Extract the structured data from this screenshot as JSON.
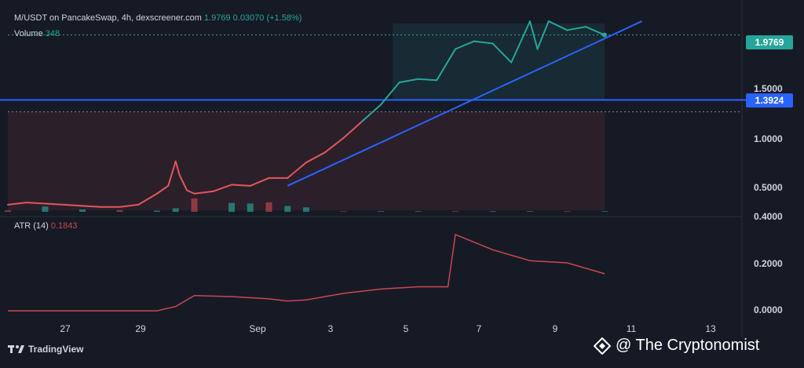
{
  "header": {
    "symbol": "M/USDT on PancakeSwap, 4h, dexscreener.com",
    "price": "1.9769",
    "change": "0.03070",
    "change_pct": "(+1.58%)",
    "volume_label": "Volume",
    "volume_value": "348"
  },
  "atr": {
    "label": "ATR (14)",
    "value": "0.1843"
  },
  "price_labels": {
    "current": "1.9769",
    "level": "1.3924"
  },
  "y_axis_price": [
    "1.5000",
    "1.0000",
    "0.5000",
    "0.4000"
  ],
  "y_axis_atr": [
    "0.2000",
    "0.0000"
  ],
  "x_axis": [
    "27",
    "29",
    "Sep",
    "3",
    "5",
    "7",
    "9",
    "11",
    "13"
  ],
  "footer": {
    "logo_text": "TradingView",
    "watermark": "@ The Cryptonomist"
  },
  "colors": {
    "up": "#26a69a",
    "down": "#c8484f",
    "trendline": "#2962ff",
    "background": "#161a25"
  },
  "chart_data": [
    {
      "type": "line",
      "title": "M/USDT on PancakeSwap, 4h, dexscreener.com",
      "x": [
        "26",
        "26.5",
        "27",
        "27.5",
        "28",
        "28.5",
        "29",
        "29.5",
        "30",
        "30.3",
        "30.5",
        "30.6",
        "30.8",
        "31",
        "31.5",
        "Sep 1",
        "1.5",
        "2",
        "2.5",
        "3",
        "3.5",
        "4",
        "4.5",
        "5",
        "5.5",
        "6",
        "6.5",
        "7",
        "7.5",
        "8",
        "8.5",
        "9",
        "9.2",
        "9.5",
        "10",
        "10.5",
        "11"
      ],
      "series": [
        {
          "values": [
            0.45,
            0.47,
            0.46,
            0.45,
            0.44,
            0.43,
            0.43,
            0.45,
            0.55,
            0.62,
            0.84,
            0.72,
            0.58,
            0.55,
            0.57,
            0.63,
            0.62,
            0.69,
            0.69,
            0.83,
            0.92,
            1.05,
            1.2,
            1.35,
            1.55,
            1.58,
            1.57,
            1.85,
            1.92,
            1.9,
            1.73,
            2.1,
            1.85,
            2.1,
            2.02,
            2.05,
            1.9769
          ]
        }
      ],
      "ylim": [
        0.4,
        2.15
      ],
      "level_line": 1.3924,
      "trendline": [
        {
          "x": "2.5",
          "y": 0.62
        },
        {
          "x": "12",
          "y": 2.1
        }
      ]
    },
    {
      "type": "bar",
      "title": "Volume",
      "categories": [
        "26",
        "27",
        "28",
        "29",
        "30",
        "30.5",
        "31",
        "Sep 1",
        "1.5",
        "2",
        "2.5",
        "3",
        "4",
        "5",
        "6",
        "7",
        "8",
        "9",
        "10",
        "11"
      ],
      "values": [
        5,
        18,
        8,
        6,
        4,
        12,
        45,
        30,
        28,
        32,
        20,
        15,
        2,
        2,
        2,
        2,
        2,
        2,
        2,
        2
      ]
    },
    {
      "type": "line",
      "title": "ATR (14)",
      "x": [
        "26",
        "28",
        "30",
        "30.5",
        "31",
        "Sep 1",
        "2",
        "2.5",
        "3",
        "4",
        "5",
        "6",
        "6.8",
        "7",
        "8",
        "9",
        "10",
        "11"
      ],
      "series": [
        {
          "values": [
            0.02,
            0.02,
            0.02,
            0.04,
            0.09,
            0.085,
            0.075,
            0.065,
            0.07,
            0.1,
            0.12,
            0.13,
            0.13,
            0.37,
            0.3,
            0.25,
            0.24,
            0.19
          ]
        }
      ],
      "ylim": [
        -0.03,
        0.42
      ]
    }
  ]
}
